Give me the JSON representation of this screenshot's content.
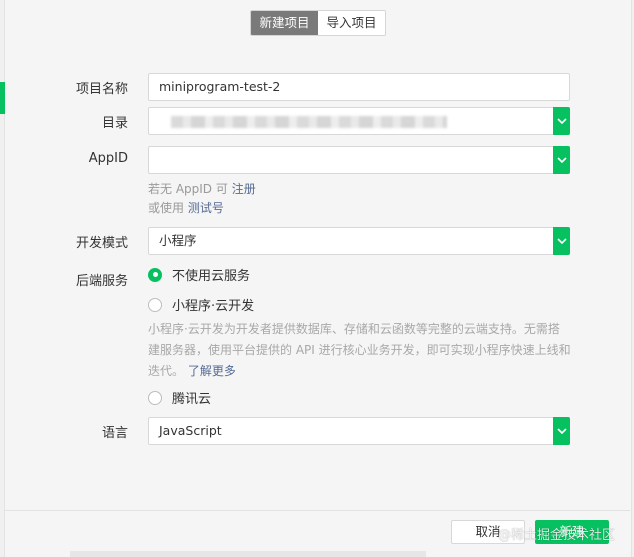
{
  "tabs": {
    "new_project": "新建项目",
    "import_project": "导入项目"
  },
  "form": {
    "project_name": {
      "label": "项目名称",
      "value": "miniprogram-test-2"
    },
    "directory": {
      "label": "目录"
    },
    "appid": {
      "label": "AppID",
      "hint_prefix": "若无 AppID 可",
      "register_link": "注册",
      "hint2_prefix": "或使用",
      "test_link": "测试号"
    },
    "dev_mode": {
      "label": "开发模式",
      "value": "小程序"
    },
    "backend": {
      "label": "后端服务",
      "options": [
        "不使用云服务",
        "小程序·云开发",
        "腾讯云"
      ],
      "selected": "不使用云服务",
      "description_line1": "小程序·云开发为开发者提供数据库、存储和云函数等完整的云端支持。无需搭",
      "description_line2": "建服务器，使用平台提供的 API 进行核心业务开发，即可实现小程序快速上线和",
      "description_line3": "迭代。",
      "learn_more": "了解更多"
    },
    "language": {
      "label": "语言",
      "value": "JavaScript"
    }
  },
  "footer": {
    "cancel": "取消",
    "create": "新建",
    "watermark": "@稀土掘金技术社区"
  },
  "colors": {
    "accent": "#07c160",
    "link": "#576b95",
    "tab_active": "#7a7a7a"
  },
  "icons": {
    "dropdown": "chevron-down-icon"
  }
}
